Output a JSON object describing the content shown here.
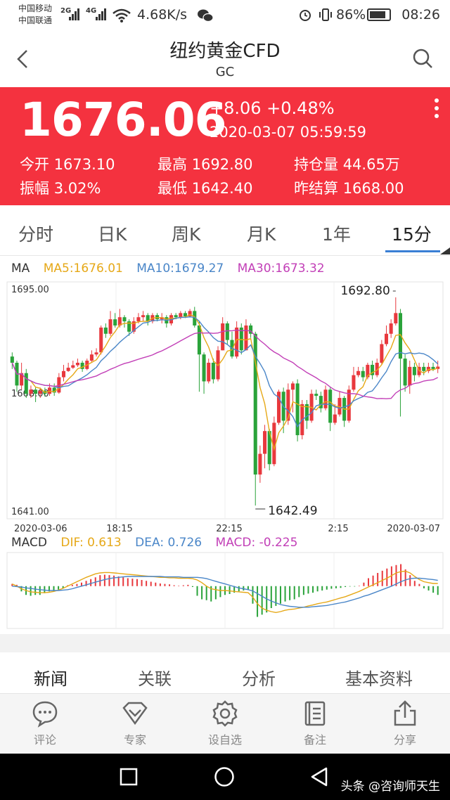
{
  "status": {
    "carrier1": "中国移动",
    "carrier2": "中国联通",
    "net1": "2G",
    "net2": "4G",
    "speed": "4.68K/s",
    "battery": "86%",
    "battery_level": 0.86,
    "time": "08:26"
  },
  "nav": {
    "title": "纽约黄金CFD",
    "code": "GC"
  },
  "quote": {
    "price": "1676.06",
    "change": "+8.06 +0.48%",
    "time": "2020-03-07 05:59:59",
    "stats": [
      {
        "label": "今开",
        "value": "1673.10"
      },
      {
        "label": "最高",
        "value": "1692.80"
      },
      {
        "label": "持仓量",
        "value": "44.65万"
      },
      {
        "label": "振幅",
        "value": "3.02%"
      },
      {
        "label": "最低",
        "value": "1642.40"
      },
      {
        "label": "昨结算",
        "value": "1668.00"
      }
    ],
    "bg_color": "#f4323f"
  },
  "period_tabs": [
    "分时",
    "日K",
    "周K",
    "月K",
    "1年",
    "15分"
  ],
  "active_period": "15分",
  "ma_legend": {
    "label": "MA",
    "ma5": "MA5:1676.01",
    "ma10": "MA10:1679.27",
    "ma30": "MA30:1673.32"
  },
  "macd_legend": {
    "label": "MACD",
    "dif": "DIF: 0.613",
    "dea": "DEA: 0.726",
    "macd": "MACD: -0.225"
  },
  "colors": {
    "up": "#e8383d",
    "down": "#2aa33a",
    "ma5": "#e6a817",
    "ma10": "#4a86c8",
    "ma30": "#c23fb7",
    "dif": "#e6a817",
    "dea": "#4a86c8"
  },
  "chart_data": {
    "type": "candlestick",
    "ylim": [
      1641.0,
      1695.0
    ],
    "ytick_labels": [
      "1695.00",
      "1668.00",
      "1641.00"
    ],
    "x_tick_labels": [
      "2020-03-06",
      "18:15",
      "22:15",
      "2:15",
      "2020-03-07"
    ],
    "annotations": {
      "high": "1692.80",
      "low": "1642.49"
    },
    "candles": [
      [
        1678.5,
        1677.0,
        1679.5,
        1675.5
      ],
      [
        1677.0,
        1671.5,
        1677.5,
        1670.0
      ],
      [
        1671.5,
        1674.5,
        1677.0,
        1670.5
      ],
      [
        1674.5,
        1669.5,
        1675.5,
        1668.5
      ],
      [
        1669.5,
        1670.5,
        1671.5,
        1668.5
      ],
      [
        1670.5,
        1669.5,
        1671.0,
        1667.5
      ],
      [
        1669.5,
        1670.2,
        1671.0,
        1668.5
      ],
      [
        1670.2,
        1669.5,
        1671.0,
        1668.8
      ],
      [
        1669.5,
        1671.0,
        1672.0,
        1669.0
      ],
      [
        1671.0,
        1669.8,
        1672.0,
        1669.0
      ],
      [
        1669.8,
        1673.5,
        1674.5,
        1669.5
      ],
      [
        1673.5,
        1675.0,
        1676.5,
        1672.5
      ],
      [
        1675.0,
        1675.8,
        1677.0,
        1674.8
      ],
      [
        1675.8,
        1676.4,
        1677.5,
        1675.5
      ],
      [
        1676.4,
        1677.0,
        1678.0,
        1676.0
      ],
      [
        1677.0,
        1675.5,
        1677.5,
        1674.8
      ],
      [
        1675.5,
        1677.5,
        1678.0,
        1675.2
      ],
      [
        1677.5,
        1679.0,
        1680.0,
        1677.0
      ],
      [
        1679.0,
        1679.5,
        1680.5,
        1678.5
      ],
      [
        1679.5,
        1685.5,
        1686.0,
        1679.0
      ],
      [
        1685.5,
        1684.0,
        1686.5,
        1683.0
      ],
      [
        1684.0,
        1687.5,
        1689.5,
        1683.5
      ],
      [
        1687.5,
        1686.0,
        1689.0,
        1685.5
      ],
      [
        1686.0,
        1688.0,
        1690.0,
        1685.5
      ],
      [
        1688.0,
        1687.0,
        1688.5,
        1685.5
      ],
      [
        1687.0,
        1684.5,
        1687.5,
        1683.5
      ],
      [
        1684.5,
        1687.0,
        1688.0,
        1684.0
      ],
      [
        1687.0,
        1688.0,
        1689.0,
        1686.5
      ],
      [
        1688.0,
        1688.5,
        1689.5,
        1687.0
      ],
      [
        1688.5,
        1687.0,
        1689.0,
        1686.0
      ],
      [
        1687.0,
        1688.5,
        1689.0,
        1686.5
      ],
      [
        1688.5,
        1687.5,
        1689.0,
        1687.0
      ],
      [
        1687.5,
        1688.0,
        1689.0,
        1686.5
      ],
      [
        1688.0,
        1686.5,
        1688.5,
        1685.5
      ],
      [
        1686.5,
        1688.5,
        1689.0,
        1686.0
      ],
      [
        1688.5,
        1688.0,
        1689.0,
        1687.5
      ],
      [
        1688.0,
        1689.0,
        1689.5,
        1687.5
      ],
      [
        1689.0,
        1688.2,
        1689.5,
        1687.8
      ],
      [
        1688.2,
        1689.5,
        1690.0,
        1688.0
      ],
      [
        1689.5,
        1686.0,
        1690.5,
        1685.5
      ],
      [
        1686.0,
        1679.0,
        1687.0,
        1670.0
      ],
      [
        1679.0,
        1672.5,
        1679.5,
        1669.5
      ],
      [
        1672.5,
        1677.0,
        1678.0,
        1672.0
      ],
      [
        1677.0,
        1673.0,
        1678.0,
        1672.0
      ],
      [
        1673.0,
        1680.0,
        1681.0,
        1672.5
      ],
      [
        1680.0,
        1686.5,
        1688.0,
        1680.0
      ],
      [
        1686.5,
        1682.5,
        1687.0,
        1681.5
      ],
      [
        1682.5,
        1678.5,
        1684.5,
        1678.0
      ],
      [
        1678.5,
        1685.5,
        1687.0,
        1678.0
      ],
      [
        1685.5,
        1680.0,
        1686.5,
        1679.0
      ],
      [
        1680.0,
        1686.0,
        1687.5,
        1680.0
      ],
      [
        1686.0,
        1684.0,
        1686.5,
        1683.0
      ],
      [
        1684.0,
        1650.0,
        1684.5,
        1642.5
      ],
      [
        1650.0,
        1655.0,
        1657.0,
        1648.0
      ],
      [
        1655.0,
        1660.5,
        1662.0,
        1651.5
      ],
      [
        1660.5,
        1652.5,
        1661.0,
        1651.0
      ],
      [
        1652.5,
        1662.5,
        1664.0,
        1652.0
      ],
      [
        1662.5,
        1670.0,
        1670.5,
        1662.0
      ],
      [
        1670.0,
        1663.0,
        1671.0,
        1660.0
      ],
      [
        1663.0,
        1670.5,
        1672.0,
        1662.0
      ],
      [
        1670.5,
        1672.0,
        1672.5,
        1665.0
      ],
      [
        1672.0,
        1659.5,
        1673.0,
        1658.0
      ],
      [
        1659.5,
        1667.0,
        1668.0,
        1658.5
      ],
      [
        1667.0,
        1663.0,
        1668.0,
        1661.0
      ],
      [
        1663.0,
        1669.5,
        1670.5,
        1662.5
      ],
      [
        1669.5,
        1669.0,
        1670.5,
        1668.0
      ],
      [
        1669.0,
        1666.0,
        1670.0,
        1665.0
      ],
      [
        1666.0,
        1670.5,
        1671.5,
        1665.5
      ],
      [
        1670.5,
        1662.5,
        1671.0,
        1660.5
      ],
      [
        1662.5,
        1664.5,
        1667.0,
        1662.0
      ],
      [
        1664.5,
        1668.5,
        1670.0,
        1664.0
      ],
      [
        1668.5,
        1663.0,
        1669.0,
        1661.5
      ],
      [
        1663.0,
        1670.5,
        1671.5,
        1662.5
      ],
      [
        1670.5,
        1674.0,
        1676.0,
        1670.0
      ],
      [
        1674.0,
        1675.0,
        1676.0,
        1673.5
      ],
      [
        1675.0,
        1673.5,
        1676.0,
        1672.5
      ],
      [
        1673.5,
        1676.5,
        1677.0,
        1673.0
      ],
      [
        1676.5,
        1674.0,
        1677.5,
        1673.0
      ],
      [
        1674.0,
        1677.0,
        1678.0,
        1673.5
      ],
      [
        1677.0,
        1681.5,
        1682.5,
        1676.5
      ],
      [
        1681.5,
        1684.0,
        1686.0,
        1681.0
      ],
      [
        1684.0,
        1686.5,
        1687.5,
        1683.0
      ],
      [
        1686.5,
        1689.0,
        1692.8,
        1686.0
      ],
      [
        1689.0,
        1678.0,
        1690.0,
        1664.0
      ],
      [
        1678.0,
        1671.5,
        1679.0,
        1670.0
      ],
      [
        1671.5,
        1676.0,
        1677.5,
        1669.5
      ],
      [
        1676.0,
        1674.0,
        1677.0,
        1672.5
      ],
      [
        1674.0,
        1676.0,
        1677.0,
        1673.5
      ],
      [
        1676.0,
        1675.0,
        1677.0,
        1674.0
      ],
      [
        1675.0,
        1676.0,
        1677.0,
        1674.5
      ],
      [
        1676.0,
        1675.5,
        1677.0,
        1675.0
      ],
      [
        1675.5,
        1676.06,
        1677.5,
        1674.5
      ]
    ],
    "macd_ylim": [
      -0.9,
      0.7
    ],
    "macd_hist": [
      0.05,
      0.03,
      -0.12,
      -0.2,
      -0.22,
      -0.2,
      -0.2,
      -0.16,
      -0.12,
      -0.12,
      -0.08,
      -0.05,
      0.02,
      0.03,
      0.05,
      0.08,
      0.12,
      0.16,
      0.2,
      0.25,
      0.26,
      0.25,
      0.24,
      0.22,
      0.2,
      0.18,
      0.17,
      0.16,
      0.14,
      0.12,
      0.1,
      0.08,
      0.06,
      0.05,
      0.04,
      0.02,
      0.01,
      0.02,
      0.03,
      -0.02,
      -0.22,
      -0.3,
      -0.32,
      -0.35,
      -0.3,
      -0.25,
      -0.2,
      -0.18,
      -0.15,
      -0.12,
      -0.1,
      -0.08,
      -0.4,
      -0.7,
      -0.65,
      -0.6,
      -0.5,
      -0.45,
      -0.4,
      -0.35,
      -0.32,
      -0.3,
      -0.25,
      -0.2,
      -0.17,
      -0.15,
      -0.12,
      -0.1,
      -0.08,
      -0.06,
      -0.05,
      -0.04,
      -0.02,
      -0.01,
      -0.01,
      0.01,
      0.08,
      0.18,
      0.24,
      0.3,
      0.35,
      0.4,
      0.45,
      0.48,
      0.5,
      0.38,
      0.25,
      0.12,
      0.05,
      -0.05,
      -0.1,
      -0.15,
      -0.2
    ],
    "dif": [
      0.05,
      0.0,
      -0.06,
      -0.1,
      -0.13,
      -0.14,
      -0.15,
      -0.15,
      -0.14,
      -0.12,
      -0.09,
      -0.05,
      0.0,
      0.05,
      0.1,
      0.15,
      0.2,
      0.24,
      0.28,
      0.3,
      0.31,
      0.31,
      0.3,
      0.29,
      0.28,
      0.27,
      0.26,
      0.25,
      0.24,
      0.23,
      0.22,
      0.21,
      0.2,
      0.2,
      0.19,
      0.19,
      0.18,
      0.18,
      0.18,
      0.17,
      0.14,
      0.08,
      0.0,
      -0.06,
      -0.08,
      -0.1,
      -0.1,
      -0.11,
      -0.12,
      -0.13,
      -0.14,
      -0.15,
      -0.25,
      -0.4,
      -0.5,
      -0.55,
      -0.58,
      -0.6,
      -0.58,
      -0.55,
      -0.53,
      -0.52,
      -0.5,
      -0.48,
      -0.45,
      -0.43,
      -0.4,
      -0.38,
      -0.36,
      -0.33,
      -0.3,
      -0.27,
      -0.24,
      -0.2,
      -0.16,
      -0.12,
      -0.07,
      -0.02,
      0.03,
      0.08,
      0.13,
      0.18,
      0.24,
      0.3,
      0.33,
      0.34,
      0.3,
      0.22,
      0.15,
      0.1,
      0.08,
      0.06,
      0.06
    ],
    "dea": [
      0.0,
      -0.01,
      -0.02,
      -0.04,
      -0.05,
      -0.07,
      -0.08,
      -0.09,
      -0.1,
      -0.1,
      -0.1,
      -0.09,
      -0.08,
      -0.06,
      -0.03,
      0.0,
      0.03,
      0.06,
      0.09,
      0.12,
      0.15,
      0.17,
      0.19,
      0.2,
      0.21,
      0.22,
      0.22,
      0.22,
      0.22,
      0.22,
      0.22,
      0.22,
      0.22,
      0.21,
      0.21,
      0.21,
      0.21,
      0.2,
      0.2,
      0.2,
      0.2,
      0.19,
      0.17,
      0.14,
      0.11,
      0.08,
      0.05,
      0.02,
      -0.01,
      -0.04,
      -0.06,
      -0.08,
      -0.11,
      -0.17,
      -0.23,
      -0.29,
      -0.34,
      -0.38,
      -0.42,
      -0.44,
      -0.46,
      -0.47,
      -0.48,
      -0.48,
      -0.48,
      -0.47,
      -0.46,
      -0.45,
      -0.44,
      -0.42,
      -0.4,
      -0.38,
      -0.36,
      -0.33,
      -0.3,
      -0.27,
      -0.23,
      -0.2,
      -0.16,
      -0.12,
      -0.08,
      -0.04,
      0.0,
      0.05,
      0.1,
      0.14,
      0.17,
      0.18,
      0.18,
      0.17,
      0.16,
      0.15,
      0.13
    ]
  },
  "info_tabs": [
    "新闻",
    "关联",
    "分析",
    "基本资料"
  ],
  "actions": [
    {
      "label": "评论",
      "icon": "comment-icon"
    },
    {
      "label": "专家",
      "icon": "diamond-icon"
    },
    {
      "label": "设自选",
      "icon": "gear-icon"
    },
    {
      "label": "备注",
      "icon": "note-icon"
    },
    {
      "label": "分享",
      "icon": "share-icon"
    }
  ],
  "watermark": "头条 @咨询师天生"
}
